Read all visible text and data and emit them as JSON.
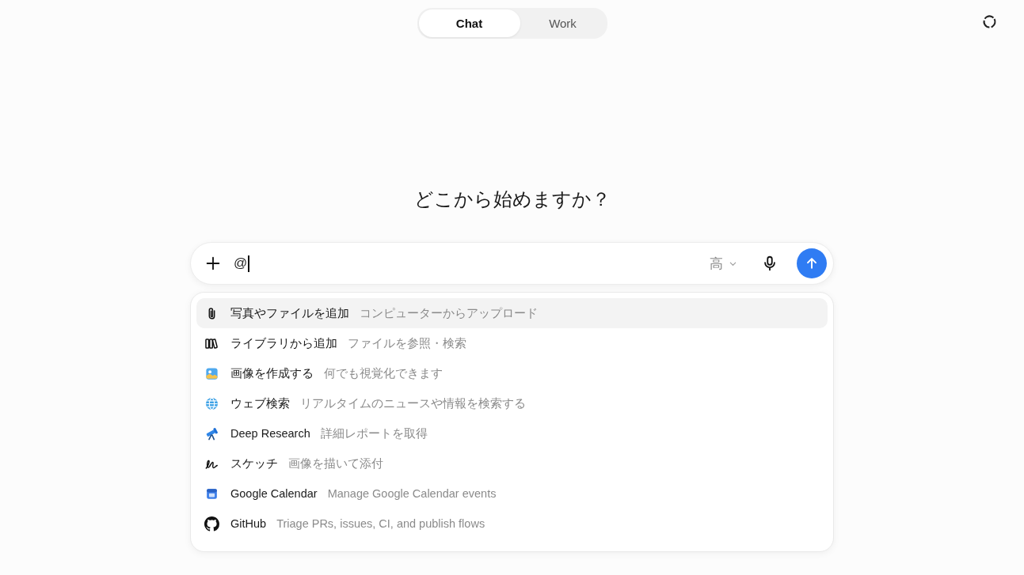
{
  "tabs": [
    {
      "label": "Chat",
      "selected": true
    },
    {
      "label": "Work",
      "selected": false
    }
  ],
  "heading": "どこから始めますか？",
  "composer": {
    "input": {
      "value": "@",
      "focused": true
    },
    "level_selector": {
      "label": "高"
    }
  },
  "menu": {
    "items": [
      {
        "kind": "attach",
        "label": "写真やファイルを追加",
        "description": "コンピューターからアップロード",
        "selected": true
      },
      {
        "kind": "library",
        "label": "ライブラリから追加",
        "description": "ファイルを参照・検索",
        "selected": false
      },
      {
        "kind": "image",
        "label": "画像を作成する",
        "description": "何でも視覚化できます",
        "selected": false
      },
      {
        "kind": "web",
        "label": "ウェブ検索",
        "description": "リアルタイムのニュースや情報を検索する",
        "selected": false
      },
      {
        "kind": "research",
        "label": "Deep Research",
        "description": "詳細レポートを取得",
        "selected": false
      },
      {
        "kind": "sketch",
        "label": "スケッチ",
        "description": "画像を描いて添付",
        "selected": false
      },
      {
        "kind": "calendar",
        "label": "Google Calendar",
        "description": "Manage Google Calendar events",
        "selected": false
      },
      {
        "kind": "repo",
        "label": "GitHub",
        "description": "Triage PRs, issues, CI, and publish flows",
        "selected": false
      }
    ]
  }
}
